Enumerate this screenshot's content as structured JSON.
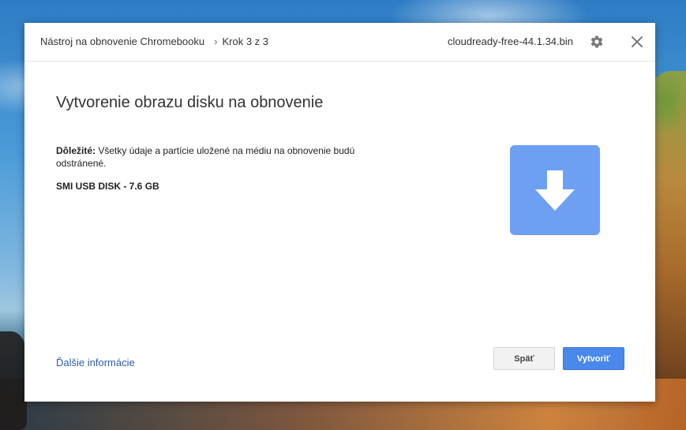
{
  "window": {
    "breadcrumb_app": "Nástroj na obnovenie Chromebooku",
    "breadcrumb_separator": "›",
    "breadcrumb_step": "Krok 3 z 3",
    "filename": "cloudready-free-44.1.34.bin",
    "settings_icon": "gear-icon",
    "close_icon": "close-icon"
  },
  "main": {
    "title": "Vytvorenie obrazu disku na obnovenie",
    "warning_label": "Dôležité:",
    "warning_text": " Všetky údaje a partície uložené na médiu na obnovenie budú odstránené.",
    "device": "SMI USB DISK - 7.6 GB",
    "illustration_icon": "download-arrow-icon"
  },
  "footer": {
    "more_info_link": "Ďalšie informácie",
    "back_button": "Späť",
    "create_button": "Vytvoriť"
  },
  "colors": {
    "accent": "#4a88ec",
    "tile": "#6ea0f2",
    "link": "#2a5db0"
  }
}
